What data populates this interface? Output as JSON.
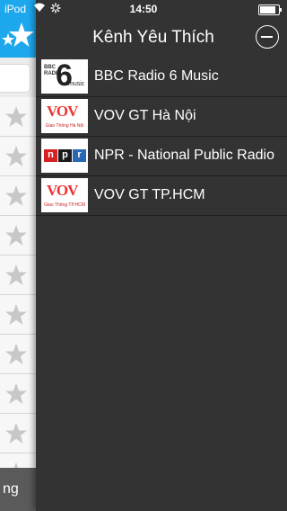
{
  "status_bar": {
    "carrier": "iPod",
    "time": "14:50"
  },
  "left_panel": {
    "bottom_label": "ng",
    "row_count": 10
  },
  "header": {
    "title": "Kênh Yêu Thích"
  },
  "favorites": [
    {
      "name": "BBC Radio 6 Music",
      "logo": "bbc-radio-6-music-logo"
    },
    {
      "name": "VOV GT Hà Nội",
      "logo": "vov-giao-thong-ha-noi-logo"
    },
    {
      "name": "NPR - National Public Radio",
      "logo": "npr-logo"
    },
    {
      "name": "VOV GT TP.HCM",
      "logo": "vov-giao-thong-tphcm-logo"
    }
  ],
  "logos": {
    "bbc_text": [
      "BBC",
      "RADIO"
    ],
    "bbc_number": "6",
    "bbc_music": "music",
    "vov_text": "VOV",
    "vov_sub_hanoi": "Giao Thông Hà Nội",
    "vov_sub_hcm": "Giao Thông TP.HCM",
    "npr_letters": [
      "n",
      "p",
      "r"
    ]
  },
  "colors": {
    "accent_blue": "#1da8ee",
    "panel_dark": "#333333",
    "star_gray": "#c8c8c8"
  }
}
